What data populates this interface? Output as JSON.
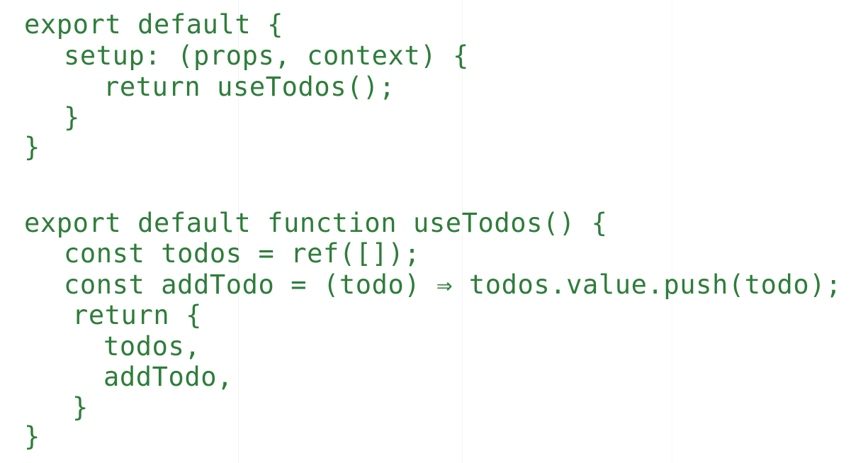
{
  "code": {
    "color": "#2e7d3a",
    "lines": [
      "export default {",
      "setup: (props, context) {",
      "return useTodos();",
      "}",
      "}",
      "export default function useTodos() {",
      "const todos = ref([]);",
      "const addTodo = (todo) ⇒ todos.value.push(todo);",
      "return {",
      "todos,",
      "addTodo,",
      "}",
      "}"
    ]
  }
}
